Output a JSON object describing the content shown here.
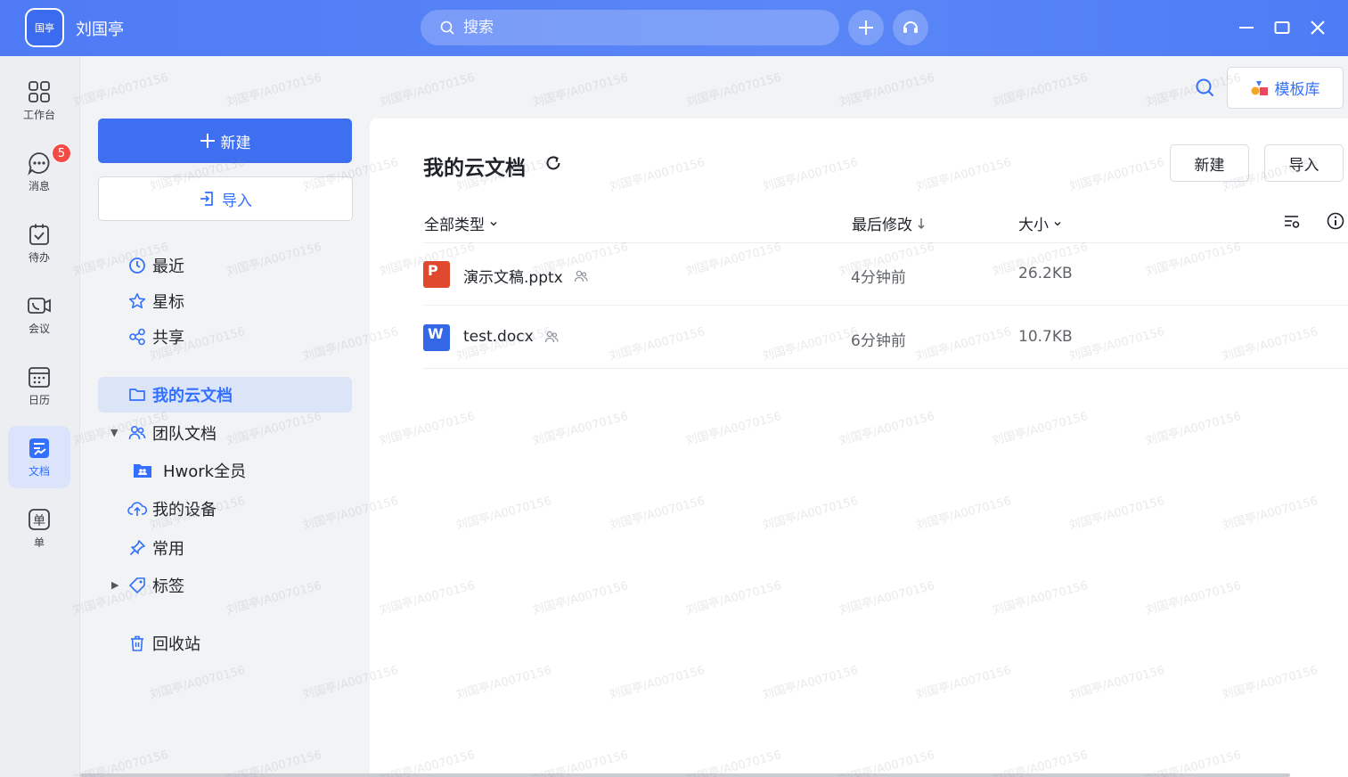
{
  "titlebar": {
    "avatar_text": "国亭",
    "username": "刘国亭",
    "search_placeholder": "搜索"
  },
  "rail": {
    "items": [
      {
        "label": "工作台",
        "icon": "workbench-icon"
      },
      {
        "label": "消息",
        "icon": "message-icon",
        "badge": "5"
      },
      {
        "label": "待办",
        "icon": "todo-icon"
      },
      {
        "label": "会议",
        "icon": "meeting-icon"
      },
      {
        "label": "日历",
        "icon": "calendar-icon"
      },
      {
        "label": "文档",
        "icon": "docs-icon",
        "active": true
      },
      {
        "label": "单",
        "icon": "form-icon"
      }
    ]
  },
  "nav": {
    "new_label": "新建",
    "import_label": "导入",
    "items": {
      "recent": "最近",
      "starred": "星标",
      "shared": "共享",
      "my_cloud": "我的云文档",
      "team_docs": "团队文档",
      "hwork_all": "Hwork全员",
      "my_devices": "我的设备",
      "frequent": "常用",
      "tags": "标签",
      "trash": "回收站"
    }
  },
  "toolbar": {
    "template_label": "模板库"
  },
  "main": {
    "title": "我的云文档",
    "new_label": "新建",
    "import_label": "导入",
    "columns": {
      "type": "全部类型",
      "modified": "最后修改",
      "size": "大小"
    },
    "files": [
      {
        "name": "演示文稿.pptx",
        "modified": "4分钟前",
        "size": "26.2KB",
        "type_letter": "P",
        "color": "#e0492e"
      },
      {
        "name": "test.docx",
        "modified": "6分钟前",
        "size": "10.7KB",
        "type_letter": "W",
        "color": "#3367e6"
      }
    ]
  },
  "watermark": "刘国亭/A0070156",
  "colors": {
    "accent": "#3370ff",
    "titlebar": "#4e7bf5",
    "badge": "#f54a45"
  }
}
